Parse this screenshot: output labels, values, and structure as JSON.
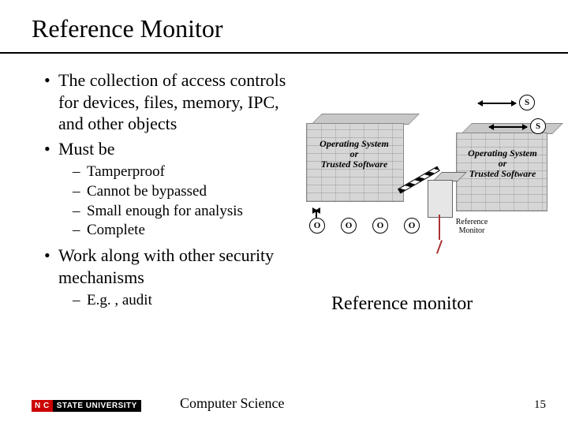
{
  "title": "Reference Monitor",
  "bullets": {
    "b1": "The collection of access controls for devices, files, memory, IPC, and other objects",
    "b2": "Must be",
    "b2sub": {
      "s1": "Tamperproof",
      "s2": "Cannot be bypassed",
      "s3": "Small enough for analysis",
      "s4": "Complete"
    },
    "b3": "Work along with other security mechanisms",
    "b3sub": {
      "s1": "E.g. , audit"
    }
  },
  "figure": {
    "wall_label_1a": "Operating System",
    "wall_label_1b": "or",
    "wall_label_1c": "Trusted Software",
    "node_o": "O",
    "node_s": "S",
    "rm_label_a": "Reference",
    "rm_label_b": "Monitor"
  },
  "caption": "Reference monitor",
  "footer": {
    "badge_left": "N C",
    "badge_right": "STATE UNIVERSITY",
    "dept": "Computer Science",
    "page": "15"
  }
}
